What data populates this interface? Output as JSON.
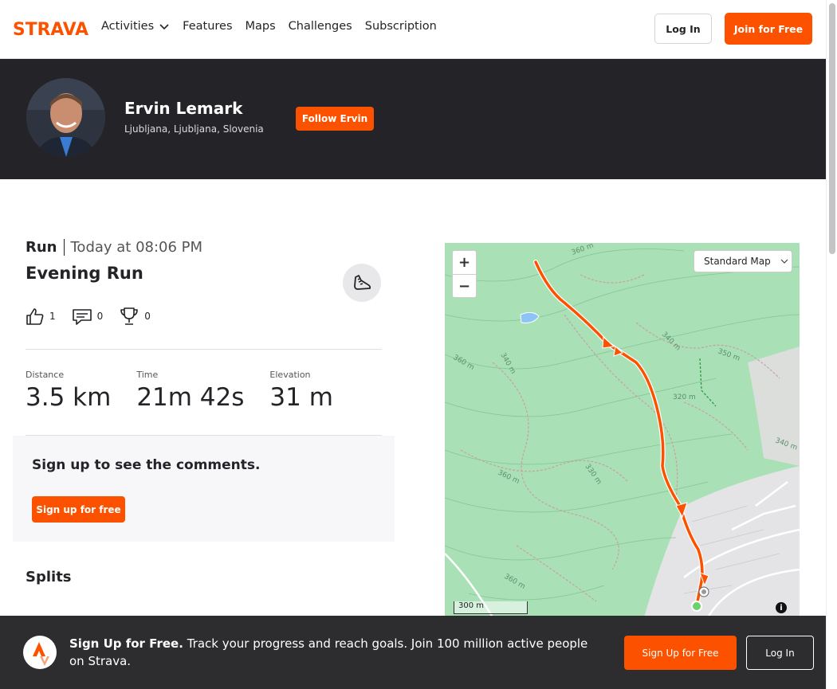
{
  "brand": {
    "logo_text": "STRAVA",
    "accent_color": "#fc5200"
  },
  "nav": {
    "items": [
      {
        "label": "Activities",
        "has_dropdown": true
      },
      {
        "label": "Features"
      },
      {
        "label": "Maps"
      },
      {
        "label": "Challenges"
      },
      {
        "label": "Subscription"
      }
    ],
    "login_label": "Log In",
    "join_label": "Join for Free"
  },
  "athlete": {
    "name": "Ervin Lemark",
    "location": "Ljubljana, Ljubljana, Slovenia",
    "follow_label": "Follow Ervin"
  },
  "activity": {
    "type": "Run",
    "date": "Today at 08:06 PM",
    "title": "Evening Run",
    "kudos": "1",
    "comments": "0",
    "achievements": "0",
    "stats": [
      {
        "label": "Distance",
        "value": "3.5 km"
      },
      {
        "label": "Time",
        "value": "21m 42s"
      },
      {
        "label": "Elevation",
        "value": "31 m"
      }
    ]
  },
  "comments_section": {
    "title": "Sign up to see the comments.",
    "button_label": "Sign up for free"
  },
  "splits": {
    "title": "Splits"
  },
  "map": {
    "style_select": "Standard Map",
    "zoom_in": "+",
    "zoom_out": "−",
    "scale_label": "300 m",
    "info": "i",
    "contour_labels": [
      "360 m",
      "360 m",
      "340 m",
      "340 m",
      "350 m",
      "320 m",
      "340 m",
      "360 m",
      "330 m",
      "360 m"
    ]
  },
  "bottom_bar": {
    "headline": "Sign Up for Free.",
    "text": "Track your progress and reach goals. Join 100 million active people on Strava.",
    "signup_label": "Sign Up for Free",
    "login_label": "Log In"
  }
}
